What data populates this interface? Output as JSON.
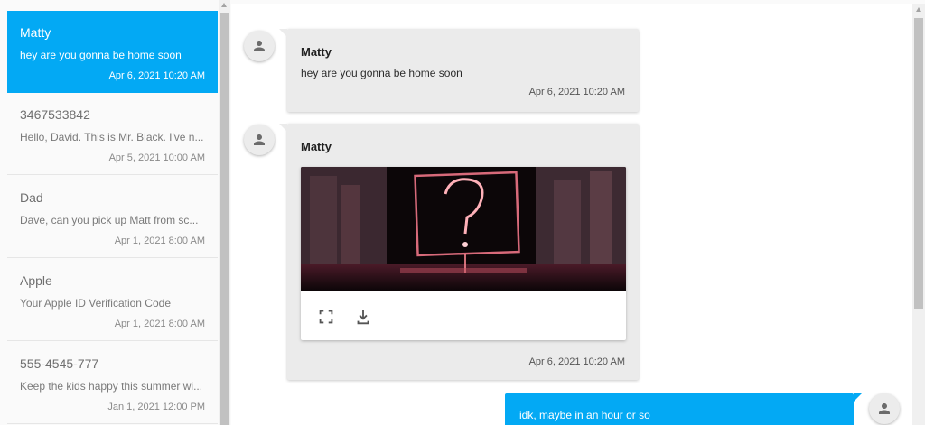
{
  "conversations": [
    {
      "name": "Matty",
      "preview": "hey are you gonna be home soon",
      "time": "Apr 6, 2021 10:20 AM",
      "active": true
    },
    {
      "name": "3467533842",
      "preview": "Hello, David. This is Mr. Black. I've n...",
      "time": "Apr 5, 2021 10:00 AM"
    },
    {
      "name": "Dad",
      "preview": "Dave, can you pick up Matt from sc...",
      "time": "Apr 1, 2021 8:00 AM"
    },
    {
      "name": "Apple",
      "preview": "Your Apple ID Verification Code",
      "time": "Apr 1, 2021 8:00 AM"
    },
    {
      "name": "555-4545-777",
      "preview": "Keep the kids happy this summer wi...",
      "time": "Jan 1, 2021 12:00 PM"
    }
  ],
  "thread": {
    "messages": [
      {
        "sender": "Matty",
        "text": "hey are you gonna be home soon",
        "time": "Apr 6, 2021 10:20 AM"
      },
      {
        "sender": "Matty",
        "attachment": "image",
        "time": "Apr 6, 2021 10:20 AM"
      },
      {
        "outgoing": true,
        "text": "idk, maybe in an hour or so"
      }
    ]
  },
  "icons": {
    "avatar": "person-icon",
    "expand": "fullscreen-icon",
    "download": "download-icon"
  },
  "colors": {
    "accent": "#03a9f4",
    "bubble_incoming": "#ebebeb",
    "sidebar_bg": "#fafafa"
  }
}
